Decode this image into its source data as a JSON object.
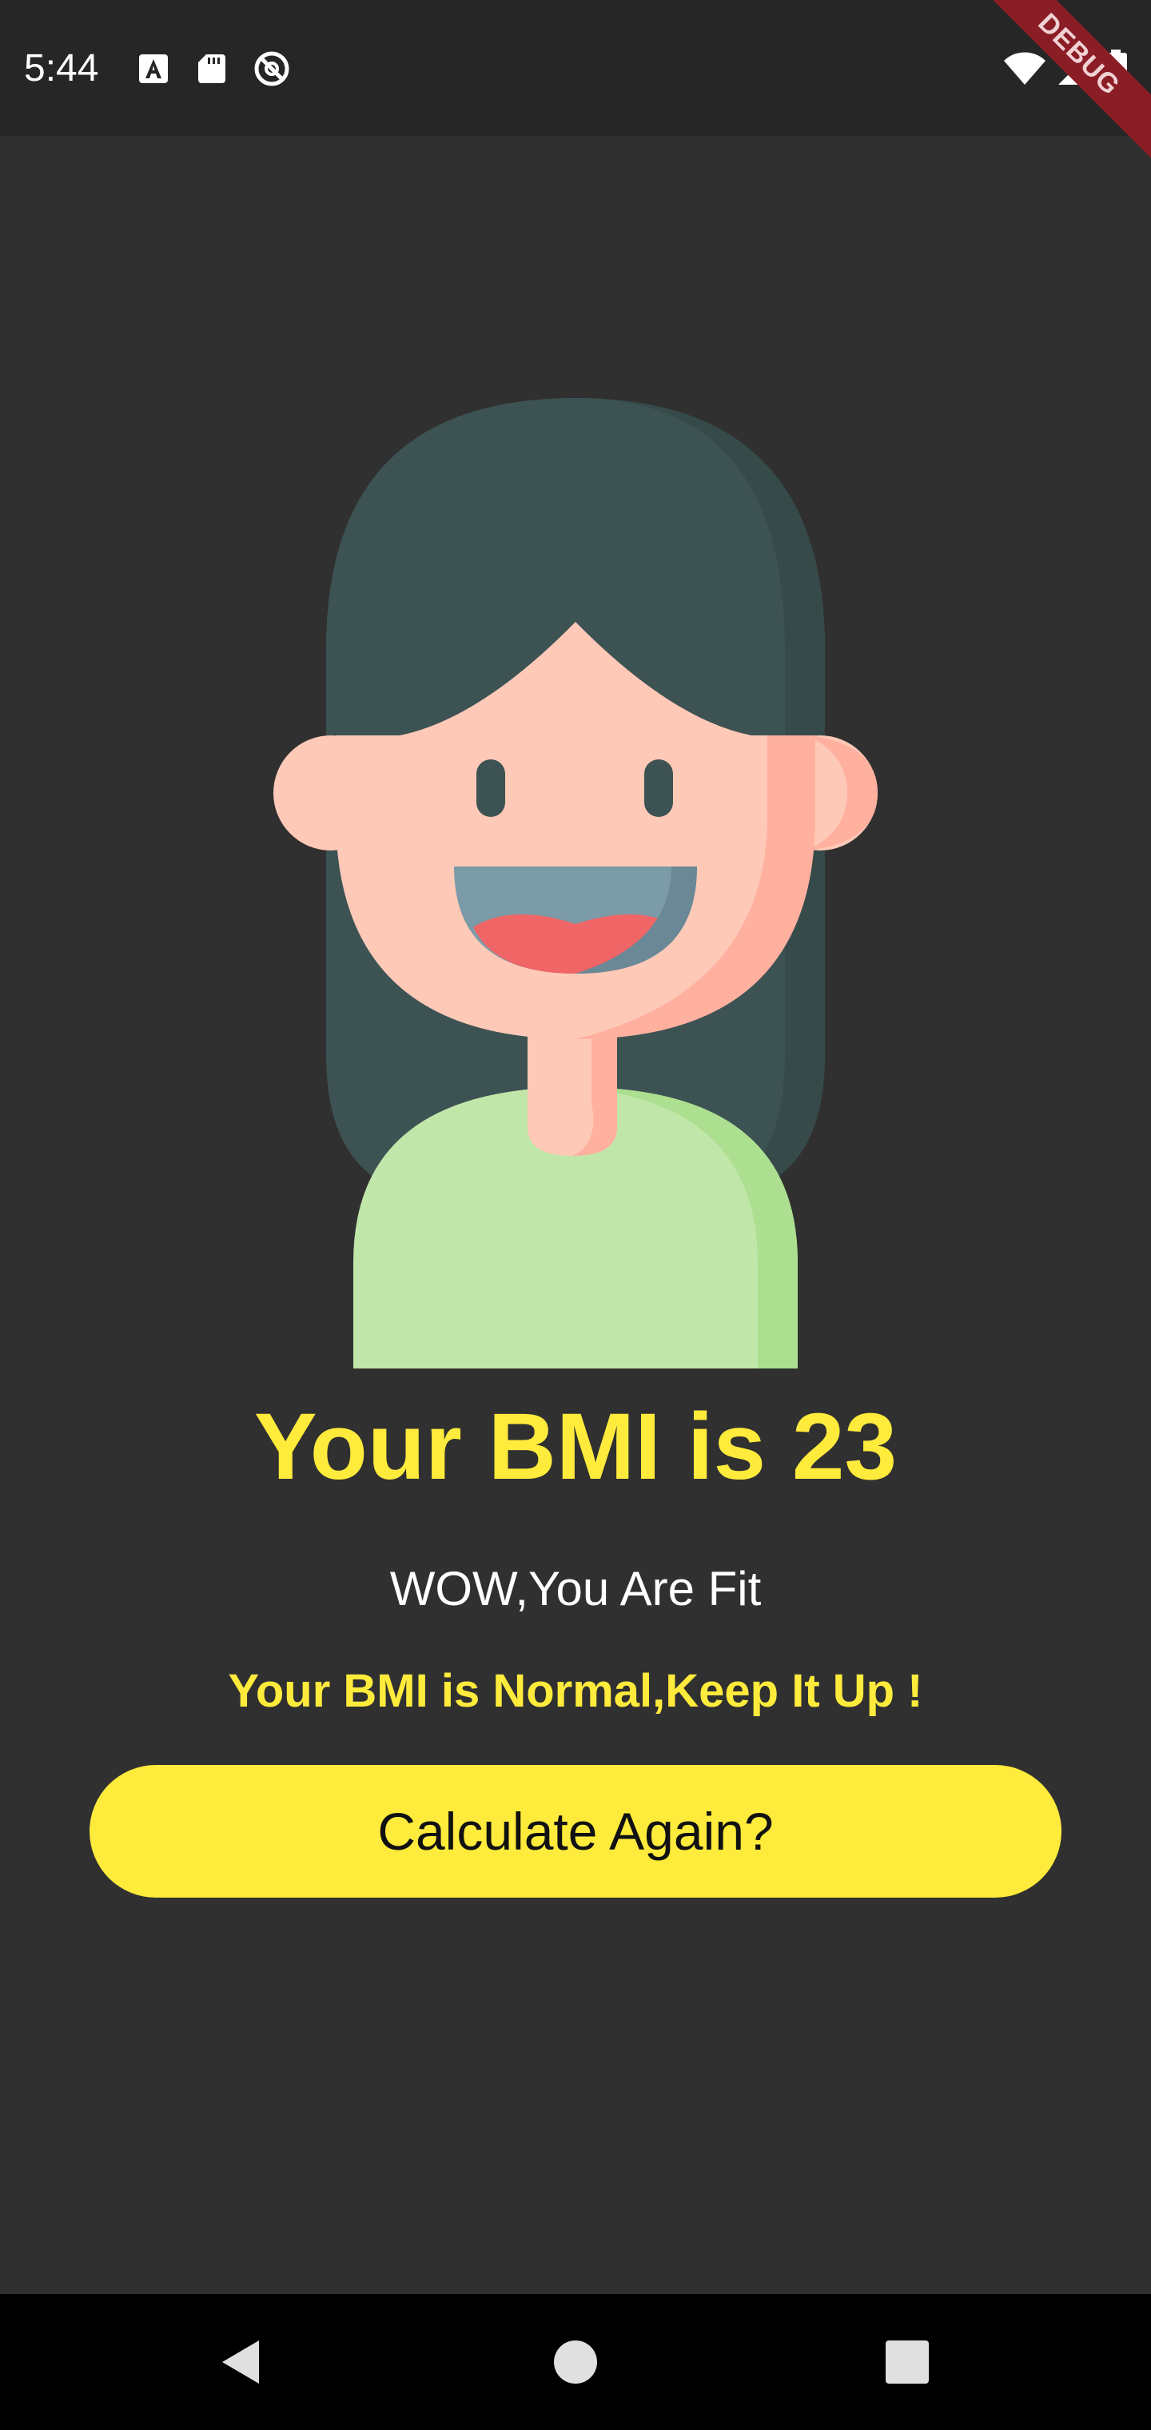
{
  "status_bar": {
    "time": "5:44",
    "debug_banner": "DEBUG",
    "icons": [
      "font-a-icon",
      "sd-card-icon",
      "at-sign-icon",
      "wifi-icon",
      "cellular-signal-icon",
      "battery-icon"
    ]
  },
  "result": {
    "title": "Your BMI is 23",
    "status": "WOW,You Are Fit",
    "message": "Your BMI is Normal,Keep It Up !"
  },
  "actions": {
    "recalculate_label": "Calculate Again?"
  },
  "nav_bar": {
    "buttons": [
      "back-icon",
      "home-icon",
      "recents-icon"
    ]
  },
  "colors": {
    "background": "#303030",
    "status_bar": "#262626",
    "accent": "#ffeb3b",
    "text": "#ffffff",
    "button_text": "#111111",
    "nav_bar": "#000000",
    "debug_banner": "#8b1d26"
  }
}
